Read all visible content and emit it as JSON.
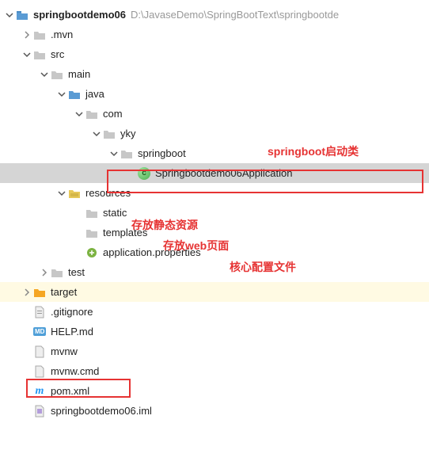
{
  "root": {
    "name": "springbootdemo06",
    "path": "D:\\JavaseDemo\\SpringBootText\\springbootde"
  },
  "nodes": {
    "mvn": ".mvn",
    "src": "src",
    "main": "main",
    "java": "java",
    "com": "com",
    "yky": "yky",
    "springboot": "springboot",
    "app_class": "Springbootdemo06Application",
    "resources": "resources",
    "static": "static",
    "templates": "templates",
    "app_properties": "application.properties",
    "test": "test",
    "target": "target",
    "gitignore": ".gitignore",
    "help": "HELP.md",
    "mvnw": "mvnw",
    "mvnw_cmd": "mvnw.cmd",
    "pom": "pom.xml",
    "iml": "springbootdemo06.iml"
  },
  "annotations": {
    "launch_class": "springboot启动类",
    "static_res": "存放静态资源",
    "templates": "存放web页面",
    "core_config": "核心配置文件"
  },
  "icons": {
    "mvn": "m"
  }
}
